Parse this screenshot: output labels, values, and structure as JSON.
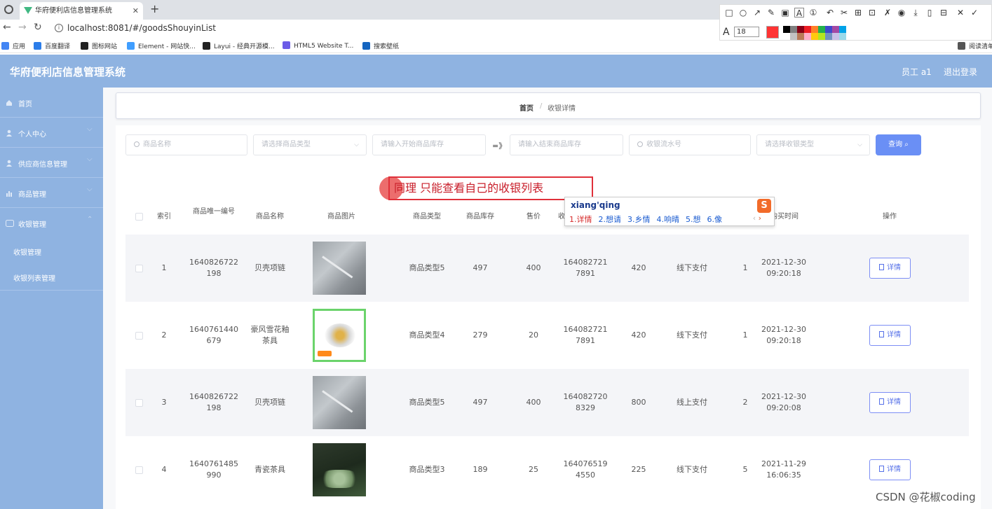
{
  "browser": {
    "tab_title": "华府便利店信息管理系统",
    "tab_close": "✕",
    "new_tab": "+",
    "url": "localhost:8081/#/goodsShouyinList",
    "bookmarks": [
      {
        "label": "应用",
        "color": "#4285f4"
      },
      {
        "label": "百度翻译",
        "color": "#2b7de9"
      },
      {
        "label": "图标网站",
        "color": "#222222"
      },
      {
        "label": "Element - 网站快...",
        "color": "#409eff"
      },
      {
        "label": "Layui - 经典开源模...",
        "color": "#222222"
      },
      {
        "label": "HTML5 Website T...",
        "color": "#6c5ce7"
      },
      {
        "label": "搜索壁纸",
        "color": "#1565c0"
      },
      {
        "label": "阅读清单",
        "color": "#555555"
      }
    ]
  },
  "annotation_toolbar": {
    "font_size": "18",
    "current_color": "#ff3333",
    "palette": [
      "#000000",
      "#7f7f7f",
      "#880015",
      "#ed1c24",
      "#ff7f27",
      "#22b14c",
      "#3f48cc",
      "#a349a4",
      "#00a2e8",
      "#ffffff",
      "#c3c3c3",
      "#b97a57",
      "#ffaec9",
      "#ffc90e",
      "#b5e61d",
      "#7092be",
      "#c8bfe7",
      "#99d9ea"
    ]
  },
  "header": {
    "app_title": "华府便利店信息管理系统",
    "user": "员工 a1",
    "logout": "退出登录"
  },
  "sidebar": {
    "items": [
      {
        "label": "首页",
        "icon": "home-icon",
        "has_chevron": false
      },
      {
        "label": "个人中心",
        "icon": "user-icon",
        "has_chevron": true
      },
      {
        "label": "供应商信息管理",
        "icon": "user-icon",
        "has_chevron": true
      },
      {
        "label": "商品管理",
        "icon": "chart-icon",
        "has_chevron": true
      },
      {
        "label": "收银管理",
        "icon": "settings-icon",
        "has_chevron": true
      }
    ],
    "sub_items": [
      "收银管理",
      "收银列表管理"
    ]
  },
  "breadcrumb": {
    "home": "首页",
    "separator": "/",
    "current": "收银详情"
  },
  "filters": {
    "goods_name": "商品名称",
    "goods_type": "请选择商品类型",
    "stock_start": "请输入开始商品库存",
    "range_sep": "=》",
    "stock_end": "请输入结束商品库存",
    "serial_no": "收银流水号",
    "cashier_type": "请选择收银类型",
    "search_button": "查询"
  },
  "annotation_text": "同理  只能查看自己的收银列表",
  "ime": {
    "pinyin": "xiang'qing",
    "candidates": [
      "1.详情",
      "2.想请",
      "3.乡情",
      "4.响晴",
      "5.想",
      "6.像"
    ],
    "logo": "S"
  },
  "table": {
    "headers": {
      "index": "索引",
      "unique_id": "商品唯一编号",
      "name": "商品名称",
      "photo": "商品图片",
      "type": "商品类型",
      "stock": "商品库存",
      "price": "售价",
      "serial_partial": "收",
      "purchase_time": "购买时间",
      "action": "操作"
    },
    "rows": [
      {
        "index": "1",
        "unique_id_line1": "1640826722",
        "unique_id_line2": "198",
        "name_line1": "贝壳项链",
        "name_line2": "",
        "type": "商品类型5",
        "stock": "497",
        "price": "400",
        "serial_line1": "164082721",
        "serial_line2": "7891",
        "total": "420",
        "pay_type": "线下支付",
        "quantity": "1",
        "date": "2021-12-30",
        "time": "09:20:18",
        "action": "详情"
      },
      {
        "index": "2",
        "unique_id_line1": "1640761440",
        "unique_id_line2": "679",
        "name_line1": "豪风雪花釉",
        "name_line2": "茶具",
        "type": "商品类型4",
        "stock": "279",
        "price": "20",
        "serial_line1": "164082721",
        "serial_line2": "7891",
        "total": "420",
        "pay_type": "线下支付",
        "quantity": "1",
        "date": "2021-12-30",
        "time": "09:20:18",
        "action": "详情"
      },
      {
        "index": "3",
        "unique_id_line1": "1640826722",
        "unique_id_line2": "198",
        "name_line1": "贝壳项链",
        "name_line2": "",
        "type": "商品类型5",
        "stock": "497",
        "price": "400",
        "serial_line1": "164082720",
        "serial_line2": "8329",
        "total": "800",
        "pay_type": "线上支付",
        "quantity": "2",
        "date": "2021-12-30",
        "time": "09:20:08",
        "action": "详情"
      },
      {
        "index": "4",
        "unique_id_line1": "1640761485",
        "unique_id_line2": "990",
        "name_line1": "青瓷茶具",
        "name_line2": "",
        "type": "商品类型3",
        "stock": "189",
        "price": "25",
        "serial_line1": "164076519",
        "serial_line2": "4550",
        "total": "225",
        "pay_type": "线下支付",
        "quantity": "5",
        "date": "2021-11-29",
        "time": "16:06:35",
        "action": "详情"
      }
    ]
  },
  "watermark": "CSDN @花椒coding"
}
